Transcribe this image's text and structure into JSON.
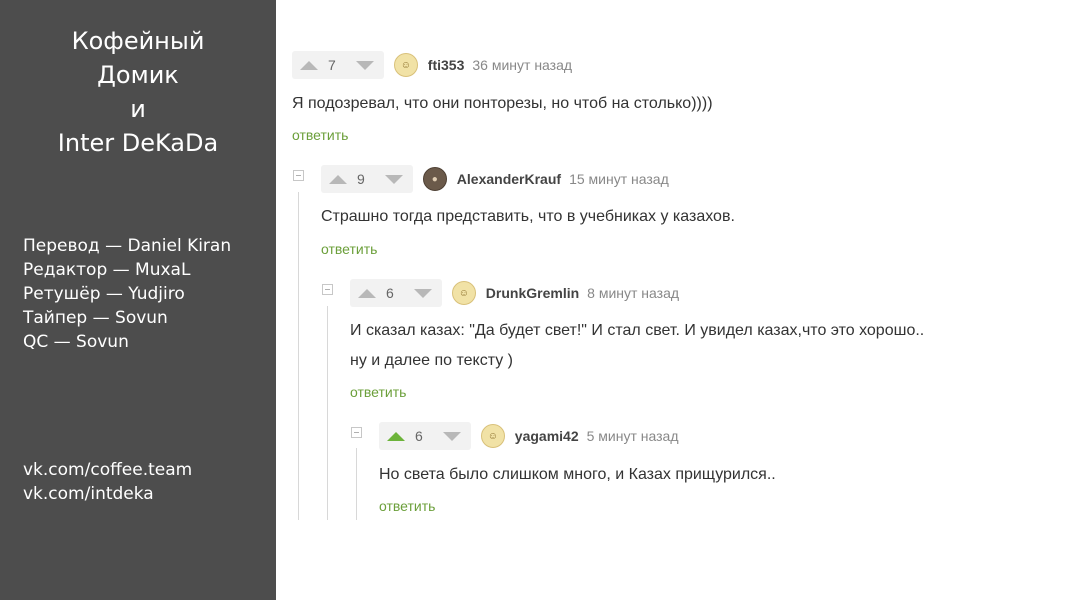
{
  "panel": {
    "title_lines": [
      "Кофейный",
      "Домик",
      "и",
      "Inter DeKaDa"
    ],
    "credits": [
      "Перевод — Daniel Kiran",
      "Редактор — MuxaL",
      "Ретушёр — Yudjiro",
      "Тайпер — Sovun",
      "QC — Sovun"
    ],
    "links": [
      "vk.com/coffee.team",
      "vk.com/intdeka"
    ]
  },
  "comments": [
    {
      "rating": "7",
      "username": "fti353",
      "time": "36 минут назад",
      "text_lines": [
        "Я подозревал, что они понторезы, но чтоб на столько))))"
      ],
      "reply_label": "ответить"
    },
    {
      "rating": "9",
      "username": "AlexanderKrauf",
      "time": "15 минут назад",
      "text_lines": [
        "Страшно тогда представить, что в учебниках у казахов."
      ],
      "reply_label": "ответить"
    },
    {
      "rating": "6",
      "username": "DrunkGremlin",
      "time": "8 минут назад",
      "text_lines": [
        "И сказал казах: \"Да будет свет!\" И стал свет. И увидел казах,что это хорошо..",
        "ну и далее по тексту )"
      ],
      "reply_label": "ответить"
    },
    {
      "rating": "6",
      "username": "yagami42",
      "time": "5 минут назад",
      "text_lines": [
        "Но света было слишком много, и Казах прищурился.."
      ],
      "reply_label": "ответить",
      "upvoted": true
    }
  ],
  "colors": {
    "panel_bg": "#4d4d4d",
    "reply_link": "#6b9f3a",
    "upvote_active": "#6cb33a"
  }
}
